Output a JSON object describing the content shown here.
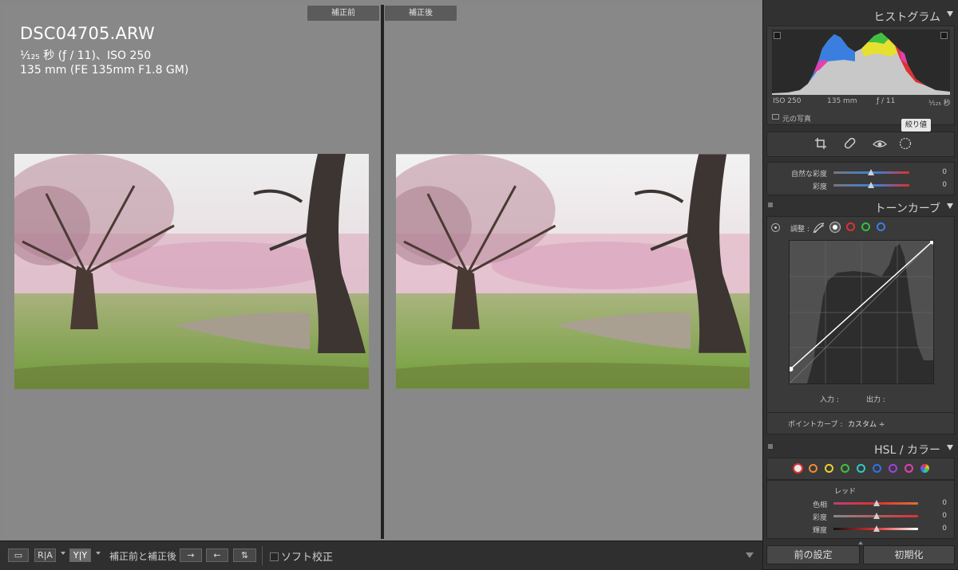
{
  "before_tag": "補正前",
  "after_tag": "補正後",
  "photo_info": {
    "filename": "DSC04705.ARW",
    "exposure": "⅟₁₂₅ 秒 (ƒ / 11)、ISO 250",
    "lens": "135 mm (FE 135mm F1.8 GM)"
  },
  "toolbar": {
    "view_loupe": "▭",
    "view_ra": "R|A",
    "view_yy": "Y|Y",
    "before_after_label": "補正前と補正後 :",
    "swap_left_right": "→",
    "copy_right_left": "←",
    "swap_icon": "⇅",
    "soft_proof_label": "ソフト校正"
  },
  "histogram": {
    "title": "ヒストグラム",
    "iso": "ISO 250",
    "focal": "135 mm",
    "aperture": "ƒ / 11",
    "shutter": "⅟₁₂₅ 秒",
    "original_photo_label": "元の写真",
    "tooltip": "絞り値"
  },
  "basic": {
    "vibrance_label": "自然な彩度",
    "vibrance_value": "0",
    "saturation_label": "彩度",
    "saturation_value": "0"
  },
  "tone_curve": {
    "title": "トーンカーブ",
    "adjust_label": "調整 :",
    "input_label": "入力 :",
    "output_label": "出力 :",
    "point_curve_label": "ポイントカーブ :",
    "point_curve_value": "カスタム ÷"
  },
  "hsl": {
    "title": "HSL / カラー",
    "color_name": "レッド",
    "hue_label": "色相",
    "hue_value": "0",
    "sat_label": "彩度",
    "sat_value": "0",
    "lum_label": "輝度",
    "lum_value": "0",
    "swatches": [
      "#e53030",
      "#f08a30",
      "#e8d030",
      "#40c040",
      "#30c8c8",
      "#3070e8",
      "#a040e0",
      "#e040b0"
    ]
  },
  "buttons": {
    "previous": "前の設定",
    "reset": "初期化"
  },
  "colors": {
    "curve_blue": "#3a7fe0",
    "curve_red": "#e03030",
    "curve_green": "#30c040"
  }
}
